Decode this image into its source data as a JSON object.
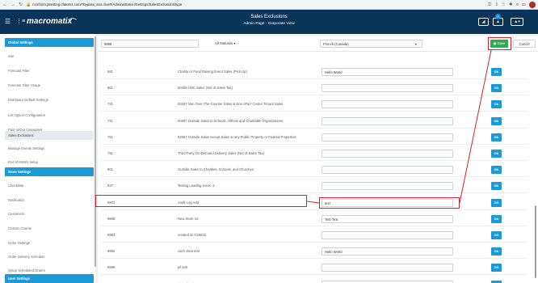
{
  "browser": {
    "url": "m.inform.jatesting.cfatoms.com/?bypass_sso=true#/Administration/Settings/SalesExclusions/type",
    "avatar_letter": "R"
  },
  "header": {
    "logo": "macromatix",
    "title": "Sales Exclusions",
    "subtitle": "Admin Page - Corporate View",
    "notification_count": "2"
  },
  "sidebar": {
    "items": [
      {
        "label": "Global Settings",
        "kind": "head"
      },
      {
        "label": "Site",
        "kind": "item"
      },
      {
        "label": "Forecast Filter",
        "kind": "item"
      },
      {
        "label": "Forecast Filter Usage",
        "kind": "item"
      },
      {
        "label": "Distributor Default Settings",
        "kind": "item"
      },
      {
        "label": "List Option Configuration",
        "kind": "item"
      },
      {
        "label": "Paid In/Out Categories",
        "kind": "item"
      },
      {
        "label": "Sales Exclusions",
        "kind": "active"
      },
      {
        "label": "Manage Events Settings",
        "kind": "item"
      },
      {
        "label": "End of Month Setup",
        "kind": "item"
      },
      {
        "label": "Store Settings",
        "kind": "head"
      },
      {
        "label": "Checklists",
        "kind": "item"
      },
      {
        "label": "Notification",
        "kind": "item"
      },
      {
        "label": "Customers",
        "kind": "item"
      },
      {
        "label": "Custom Counts",
        "kind": "item"
      },
      {
        "label": "Order Settings",
        "kind": "item"
      },
      {
        "label": "Order Delivery Schedule",
        "kind": "item"
      },
      {
        "label": "Setup Scheduled Orders",
        "kind": "item"
      },
      {
        "label": "User Settings",
        "kind": "head"
      }
    ]
  },
  "toolbar": {
    "search_value": "9868",
    "status_filter": "All Statuses",
    "language": "French (Canada)",
    "save_label": "Save",
    "cancel_label": "Cancel"
  },
  "rows": [
    {
      "code": "",
      "desc": "",
      "value": ""
    },
    {
      "code": "581",
      "desc": "Charity or Fund Raising Event Sales (Pick Up)",
      "value": "Hello World"
    },
    {
      "code": "661",
      "desc": "00409 UNC Sales (Net of Sales Tax)",
      "value": ""
    },
    {
      "code": "721",
      "desc": "03347 Non Over-The-Counter Sales & Non AT&T Center Tenant Sales",
      "value": ""
    },
    {
      "code": "741",
      "desc": "00397 Outside Sales to Schools, Offices and Charitable Organizations",
      "value": ""
    },
    {
      "code": "761",
      "desc": "02057 Outside Sales except Sales at any Public Property or Federal Properties",
      "value": ""
    },
    {
      "code": "781",
      "desc": "Third-Party On-Demand Delivery Sales (Net of Sales Tax)",
      "value": ""
    },
    {
      "code": "801",
      "desc": "Outside Sales to Charities, Schools, and Churches",
      "value": ""
    },
    {
      "code": "827",
      "desc": "Testing Leading zeros -1",
      "value": ""
    },
    {
      "code": "9801",
      "desc": "Audit Log Add",
      "value": "test"
    },
    {
      "code": "9868",
      "desc": "New Store 10",
      "value": "Test Text"
    },
    {
      "code": "9993",
      "desc": "created at 7/28n45",
      "value": ""
    },
    {
      "code": "9995",
      "desc": "cach clear test",
      "value": "Hello World"
    },
    {
      "code": "9996",
      "desc": "jel test",
      "value": ""
    },
    {
      "code": "9997",
      "desc": "show for demo",
      "value": ""
    }
  ],
  "ok_label": "OK",
  "highlight_color": "#d8202a"
}
